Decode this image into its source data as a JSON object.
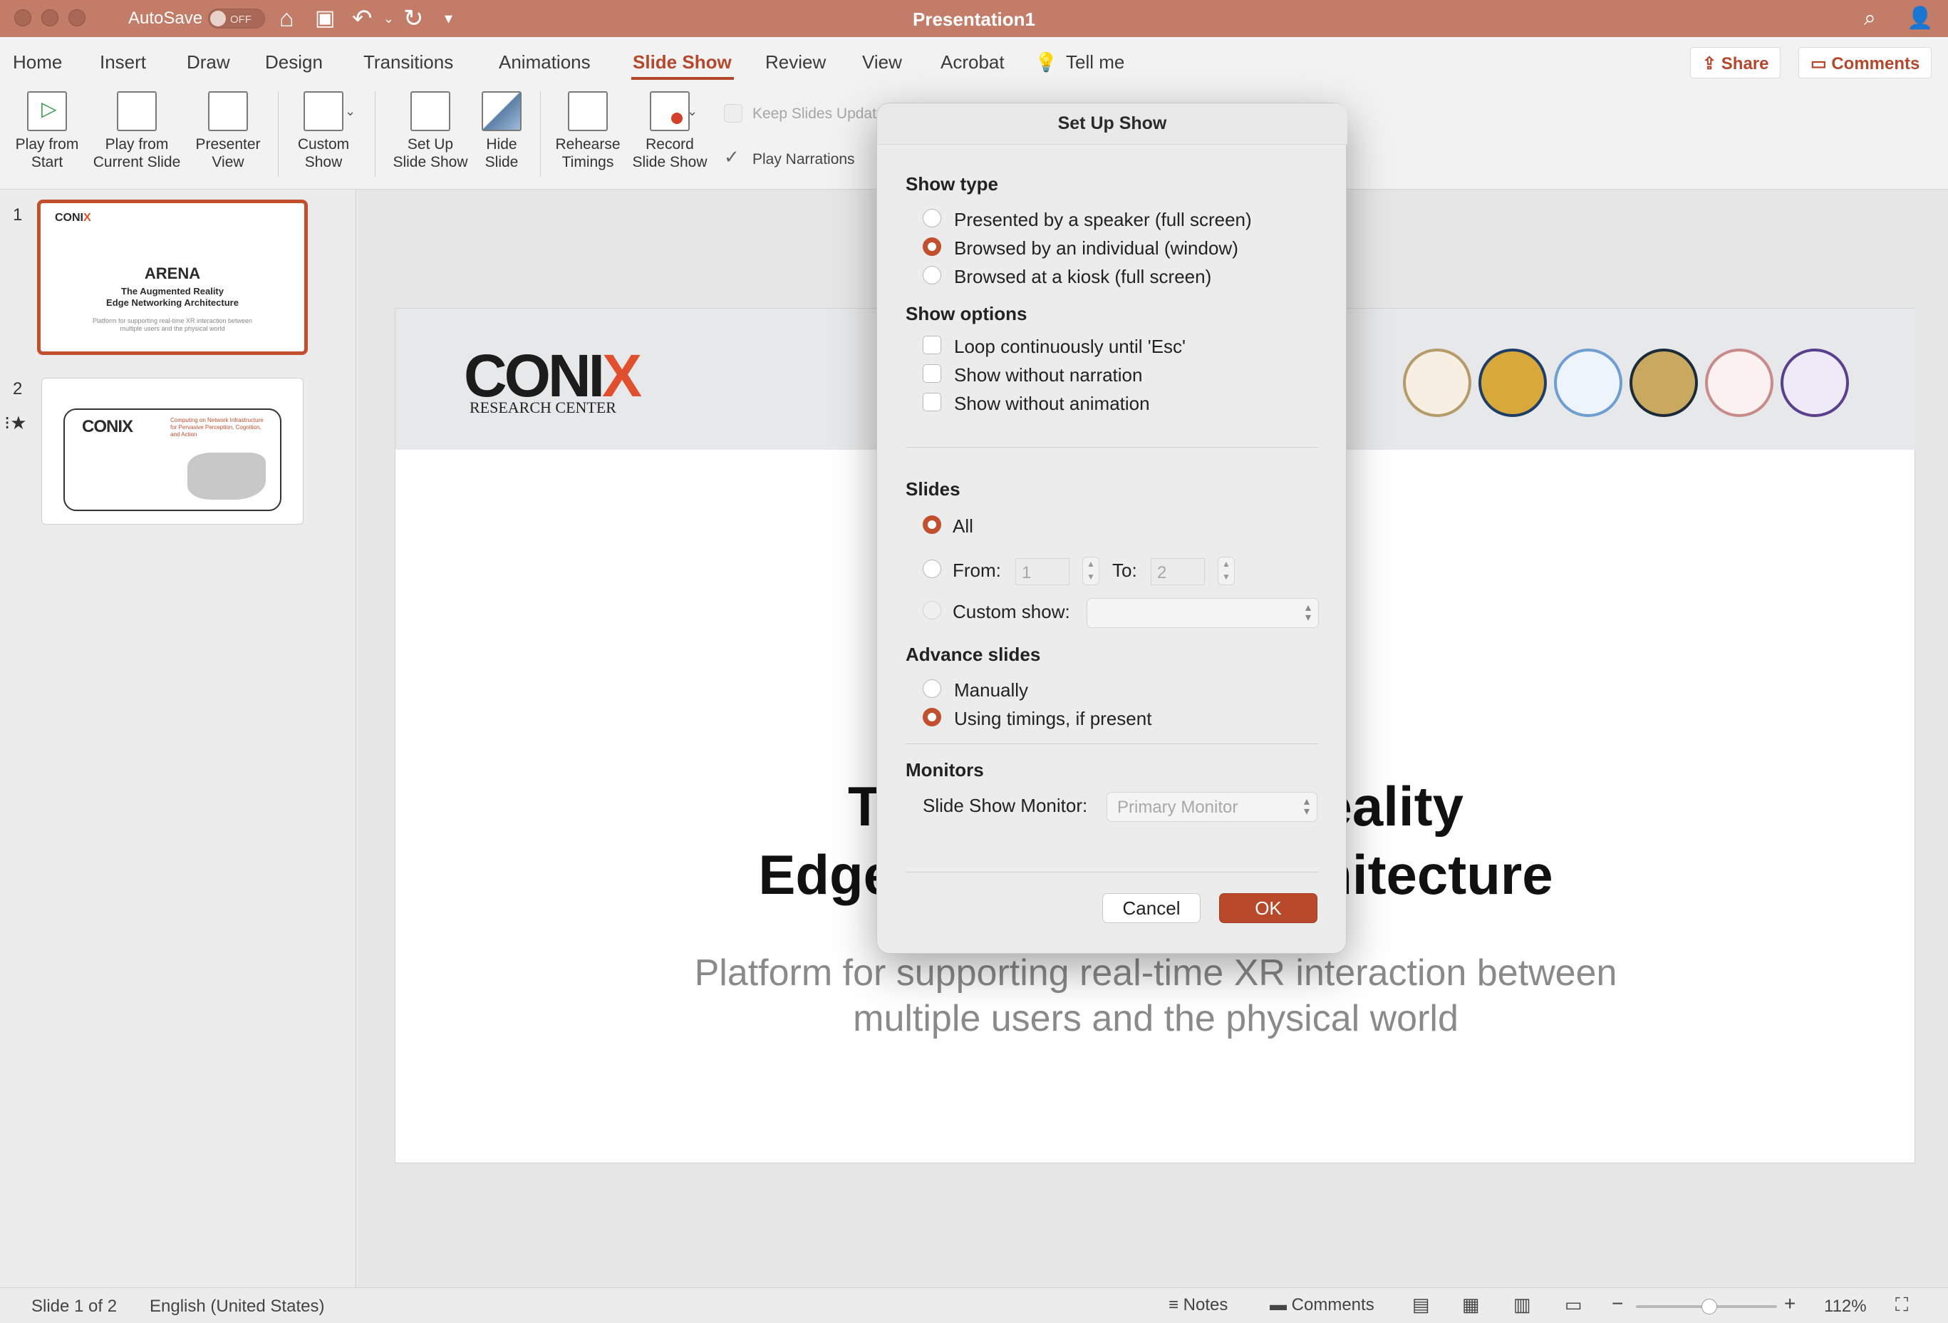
{
  "window": {
    "title": "Presentation1",
    "autosave_label": "AutoSave",
    "autosave_state": "OFF"
  },
  "tabs": [
    {
      "label": "Home"
    },
    {
      "label": "Insert"
    },
    {
      "label": "Draw"
    },
    {
      "label": "Design"
    },
    {
      "label": "Transitions"
    },
    {
      "label": "Animations"
    },
    {
      "label": "Slide Show"
    },
    {
      "label": "Review"
    },
    {
      "label": "View"
    },
    {
      "label": "Acrobat"
    },
    {
      "label": "Tell me"
    }
  ],
  "header_buttons": {
    "share": "Share",
    "comments": "Comments"
  },
  "ribbon": {
    "play_from_start": "Play from\nStart",
    "play_from_current": "Play from\nCurrent Slide",
    "presenter_view": "Presenter\nView",
    "custom_show": "Custom\nShow",
    "set_up_slide_show": "Set Up\nSlide Show",
    "hide_slide": "Hide\nSlide",
    "rehearse_timings": "Rehearse\nTimings",
    "record_slide_show": "Record\nSlide Show",
    "keep_slides_updated": "Keep Slides Updat",
    "play_narrations": "Play Narrations"
  },
  "thumbnails": [
    {
      "number": "1",
      "title": "ARENA",
      "subtitle": "The Augmented Reality\nEdge Networking Architecture",
      "body": "Platform for supporting real-time XR interaction between\nmultiple users and the physical world"
    },
    {
      "number": "2",
      "title": "CONIX",
      "subtitle": "Computing on Network Infrastructure\nfor Pervasive Perception, Cognition,\nand Action"
    }
  ],
  "slide": {
    "logo_main": "CONI",
    "logo_x": "X",
    "logo_sub": "RESEARCH CENTER",
    "title_line1": "The Augmented Reality",
    "title_line2": "Edge Networking Architecture",
    "subtitle_line1": "Platform for supporting real-time XR interaction between",
    "subtitle_line2": "multiple users and the physical world"
  },
  "dialog": {
    "title": "Set Up Show",
    "show_type": {
      "heading": "Show type",
      "options": [
        "Presented by a speaker (full screen)",
        "Browsed by an individual (window)",
        "Browsed at a kiosk (full screen)"
      ],
      "selected": "Browsed by an individual (window)"
    },
    "show_options": {
      "heading": "Show options",
      "options": [
        "Loop continuously until 'Esc'",
        "Show without narration",
        "Show without animation"
      ]
    },
    "slides": {
      "heading": "Slides",
      "all_label": "All",
      "from_label": "From:",
      "from_value": "1",
      "to_label": "To:",
      "to_value": "2",
      "custom_show_label": "Custom show:",
      "custom_show_value": ""
    },
    "advance": {
      "heading": "Advance slides",
      "options": [
        "Manually",
        "Using timings, if present"
      ],
      "selected": "Using timings, if present"
    },
    "monitors": {
      "heading": "Monitors",
      "label": "Slide Show Monitor:",
      "value": "Primary Monitor"
    },
    "cancel": "Cancel",
    "ok": "OK"
  },
  "status": {
    "slide_counter": "Slide 1 of 2",
    "language": "English (United States)",
    "notes": "Notes",
    "comments": "Comments",
    "zoom": "112%",
    "zoom_level_fraction": 0.52
  },
  "colors": {
    "titlebar": "#c27c68",
    "accent": "#c2502e"
  }
}
